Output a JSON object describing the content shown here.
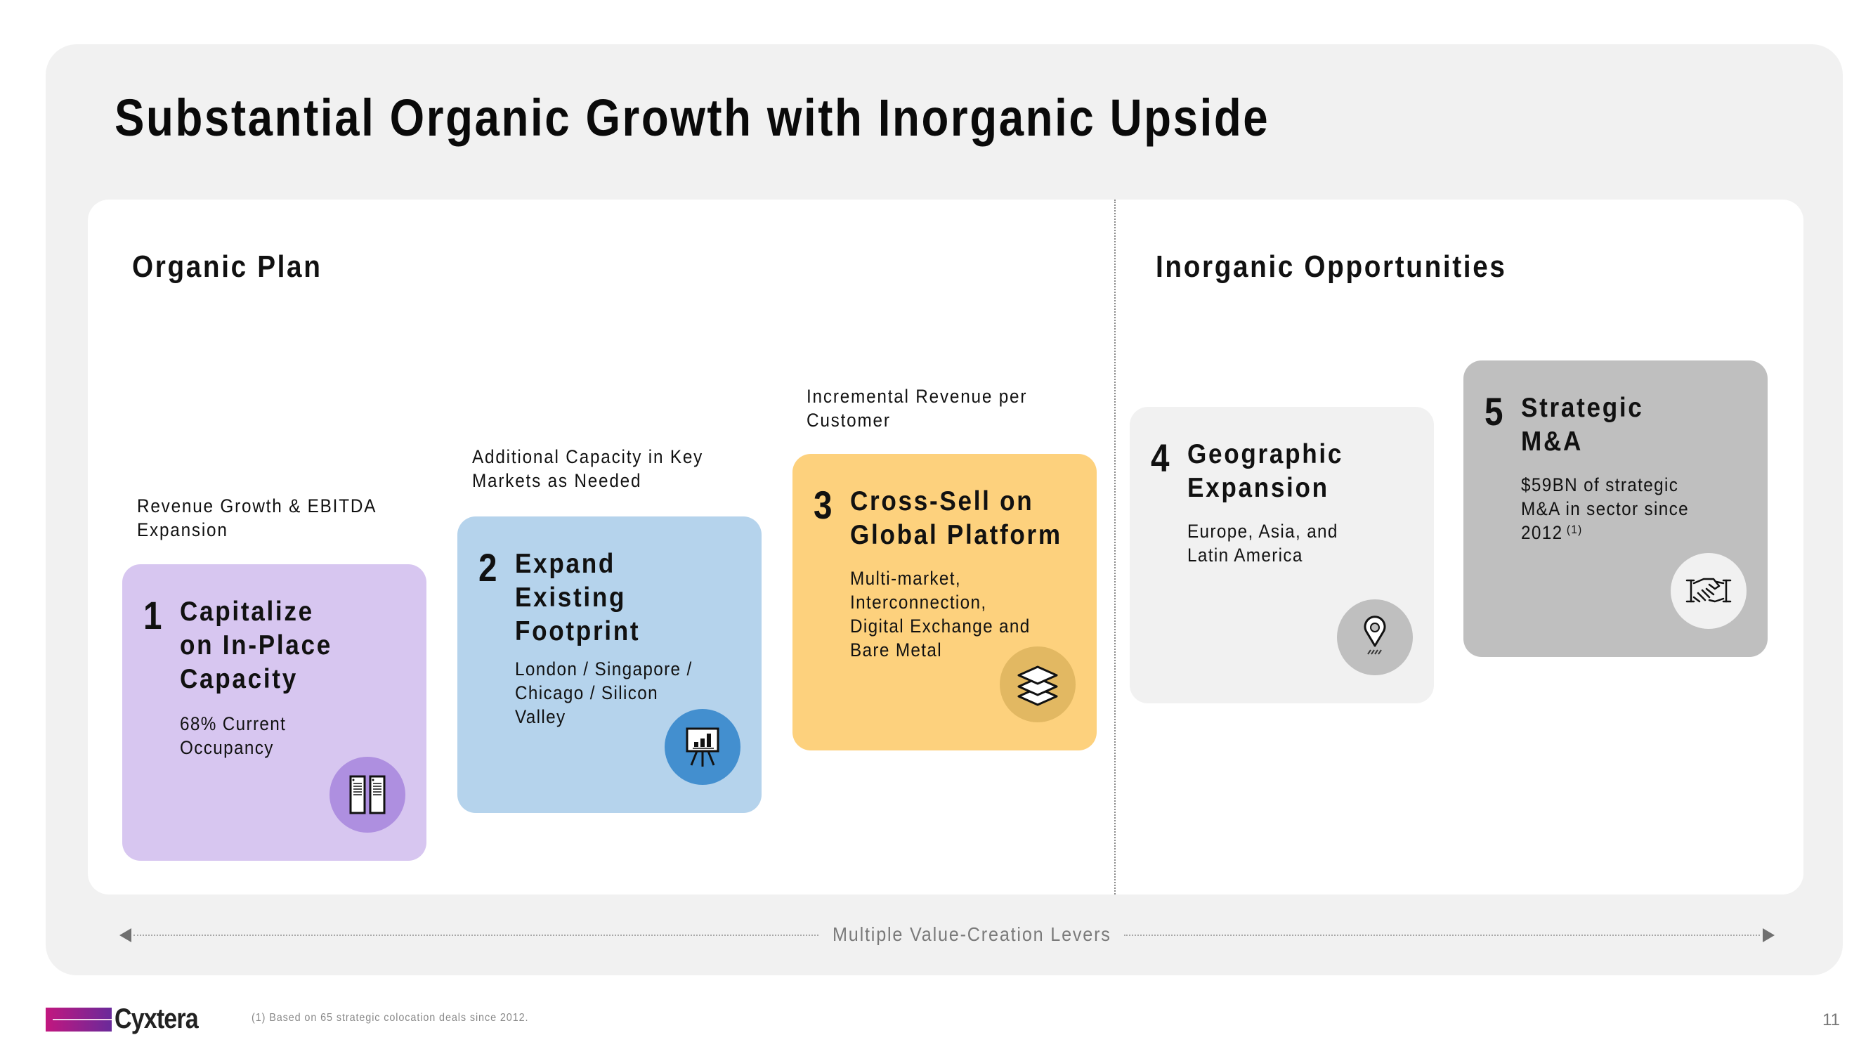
{
  "title": "Substantial Organic Growth with Inorganic Upside",
  "sections": {
    "organic": "Organic Plan",
    "inorganic": "Inorganic Opportunities"
  },
  "captions": [
    {
      "line1": "Revenue  Growth & EBITDA",
      "line2": "Expansion"
    },
    {
      "line1": "Additional Capacity in Key",
      "line2": "Markets as Needed"
    },
    {
      "line1": "Incremental Revenue  per",
      "line2": "Customer"
    }
  ],
  "cards": [
    {
      "number": "1",
      "heading": [
        "Capitalize",
        "on In-Place",
        "Capacity"
      ],
      "desc": [
        "68% Current",
        "Occupancy"
      ],
      "icon": "server-racks-icon",
      "bg": "#d7c6f0",
      "badge": "#ae8fe0"
    },
    {
      "number": "2",
      "heading": [
        "Expand",
        "Existing",
        "Footprint"
      ],
      "desc": [
        "London / Singapore /",
        "Chicago / Silicon",
        "Valley"
      ],
      "icon": "presentation-chart-icon",
      "bg": "#b5d3ec",
      "badge": "#438fcf"
    },
    {
      "number": "3",
      "heading": [
        "Cross-Sell on",
        "Global Platform"
      ],
      "desc": [
        "Multi-market,",
        "Interconnection,",
        "Digital Exchange and",
        "Bare Metal"
      ],
      "icon": "layers-icon",
      "bg": "#fdd17d",
      "badge": "#e2b862"
    },
    {
      "number": "4",
      "heading": [
        "Geographic",
        "Expansion"
      ],
      "desc": [
        "Europe, Asia, and",
        "Latin America"
      ],
      "icon": "map-pin-icon",
      "bg": "#f1f1f1",
      "badge": "#bfbfbf"
    },
    {
      "number": "5",
      "heading": [
        "Strategic",
        "M&A"
      ],
      "desc": [
        "$59BN of strategic",
        "M&A in sector since",
        "2012"
      ],
      "footnote_ref": "(1)",
      "icon": "handshake-icon",
      "bg": "#bfbfbf",
      "badge": "#f1f1f1"
    }
  ],
  "levers_label": "Multiple Value-Creation  Levers",
  "footer": {
    "logo": "Cyxtera",
    "footnote": "(1)   Based on 65 strategic colocation deals since 2012.",
    "page_number": "11"
  }
}
